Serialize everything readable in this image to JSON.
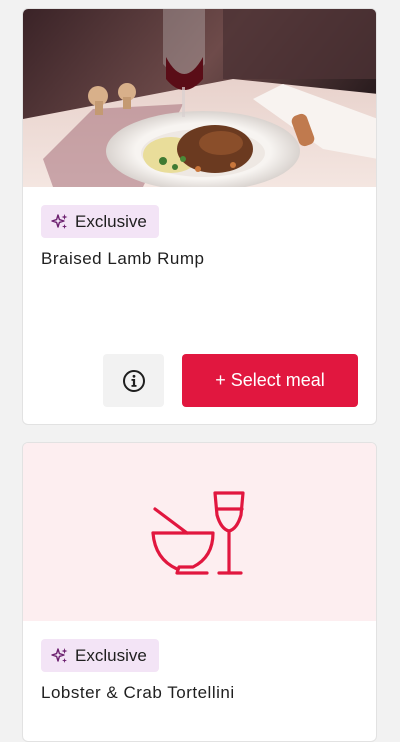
{
  "colors": {
    "accent": "#e1173f",
    "badge_background": "#f3e4f6",
    "badge_icon": "#6b1f6e",
    "placeholder_background": "#fdeef0"
  },
  "meals": [
    {
      "badge_label": "Exclusive",
      "badge_icon": "sparkle-icon",
      "name": "Braised Lamb Rump",
      "image": "braised-lamb-rump-photo",
      "info_icon": "info-icon",
      "select_label": "+ Select meal"
    },
    {
      "badge_label": "Exclusive",
      "badge_icon": "sparkle-icon",
      "name": "Lobster & Crab Tortellini",
      "image": "bowl-and-wine-glass-icon"
    }
  ]
}
